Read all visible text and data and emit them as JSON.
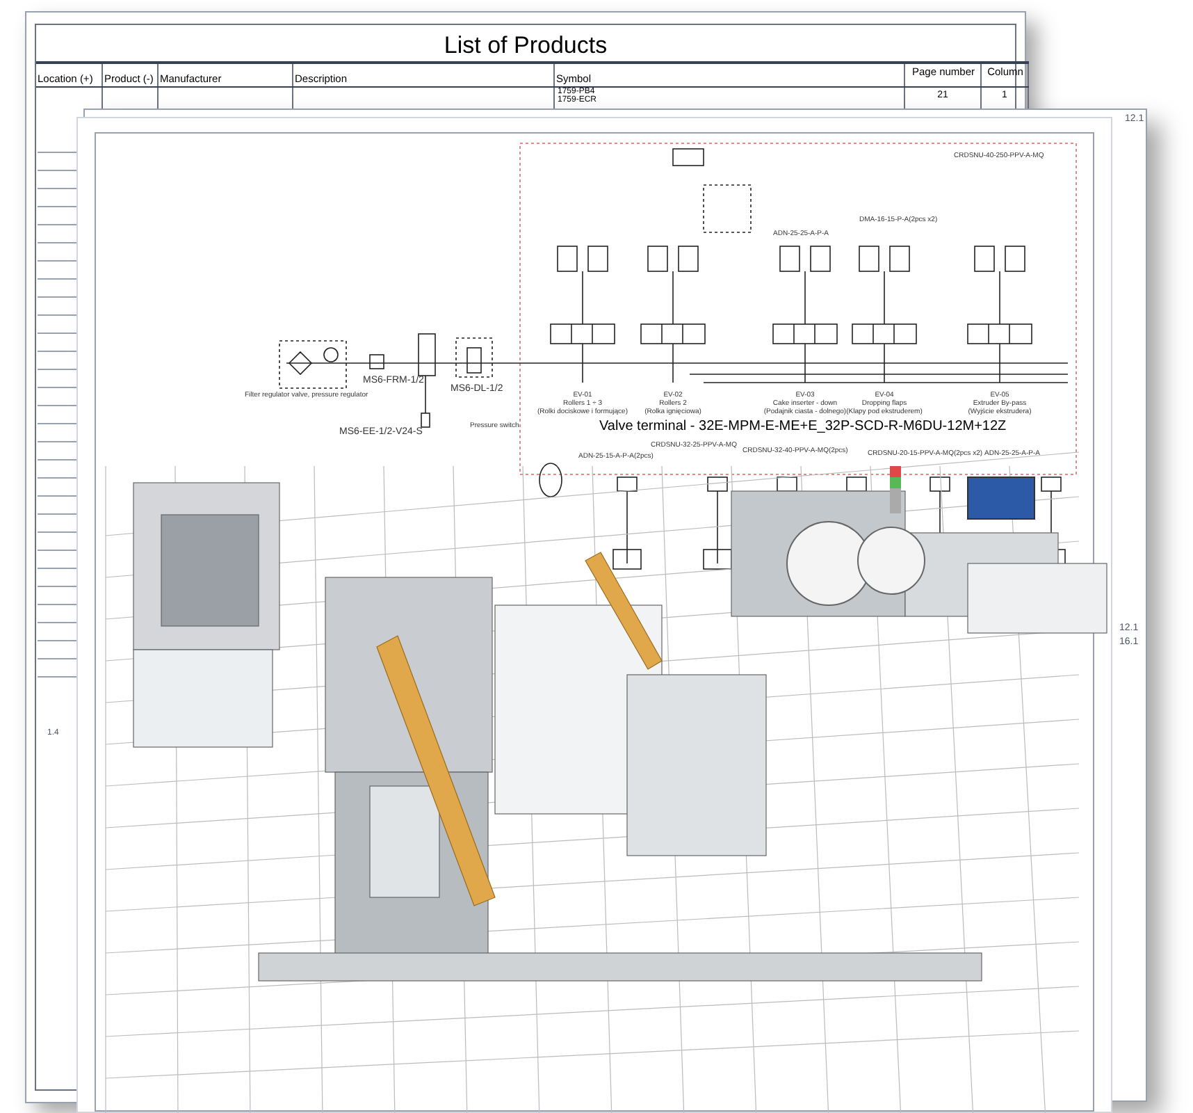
{
  "product_list": {
    "title": "List of Products",
    "columns": [
      "Location (+)",
      "Product (-)",
      "Manufacturer",
      "Description",
      "Symbol",
      "Page number",
      "Column"
    ],
    "rows": [
      {
        "symbol_lines": [
          "1759-PB4",
          "1759-ECR"
        ],
        "page_number": "21",
        "column": "1"
      }
    ]
  },
  "schematic": {
    "supply_labels": [
      {
        "text": "Filter regulator valve, pressure regulator"
      },
      {
        "text": "MS6-FRM-1/2"
      },
      {
        "text": "MS6-EE-1/2-V24-S"
      },
      {
        "text": "MS6-DL-1/2"
      },
      {
        "text": "Pressure switch"
      }
    ],
    "actuator_labels": [
      "ADN-25-25-A-P-A",
      "DMA-16-15-P-A(2pcs x2)",
      "CRDSNU-40-250-PPV-A-MQ"
    ],
    "valves": [
      {
        "code": "EV-01",
        "name": "Rollers 1 ÷ 3",
        "note": "(Rolki dociskowe i formujące)"
      },
      {
        "code": "EV-02",
        "name": "Rollers 2",
        "note": "(Rolka ignięciowa)"
      },
      {
        "code": "EV-03",
        "name": "Cake inserter - down",
        "note": "(Podajnik ciasta - dolnego)"
      },
      {
        "code": "EV-04",
        "name": "Dropping flaps",
        "note": "(Klapy pod ekstruderem)"
      },
      {
        "code": "EV-05",
        "name": "Extruder By-pass",
        "note": "(Wyjście ekstrudera)"
      }
    ],
    "terminal_title": "Valve terminal - 32E-MPM-E-ME+E_32P-SCD-R-M6DU-12M+12Z",
    "lower_labels": [
      "ADN-25-15-A-P-A(2pcs)",
      "CRDSNU-32-25-PPV-A-MQ",
      "CRDSNU-32-40-PPV-A-MQ(2pcs)",
      "CRDSNU-20-15-PPV-A-MQ(2pcs x2)",
      "ADN-25-25-A-P-A"
    ]
  },
  "cross_references": [
    "12.1",
    "12.1",
    "16.1",
    "1.4"
  ]
}
